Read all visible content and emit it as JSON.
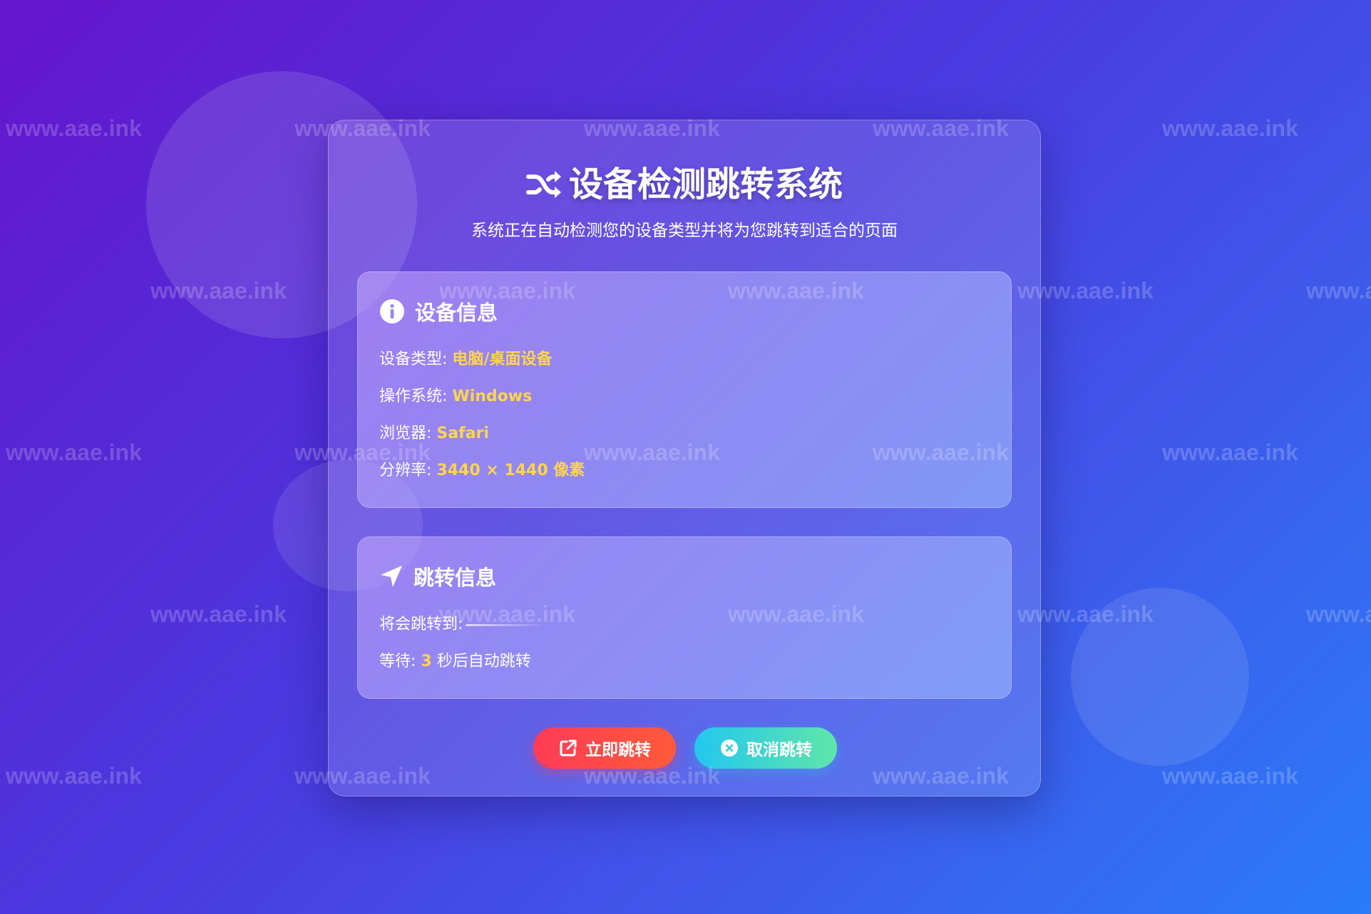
{
  "header": {
    "title": "设备检测跳转系统",
    "subtitle": "系统正在自动检测您的设备类型并将为您跳转到适合的页面",
    "title_icon": "shuffle-icon"
  },
  "device_panel": {
    "heading": "设备信息",
    "heading_icon": "info-circle-icon",
    "rows": [
      {
        "label": "设备类型:",
        "value": "电脑/桌面设备"
      },
      {
        "label": "操作系统:",
        "value": "Windows"
      },
      {
        "label": "浏览器:",
        "value": "Safari"
      },
      {
        "label": "分辨率:",
        "value": "3440 × 1440 像素"
      }
    ]
  },
  "redirect_panel": {
    "heading": "跳转信息",
    "heading_icon": "location-arrow-icon",
    "target_label": "将会跳转到:",
    "wait_label": "等待:",
    "wait_seconds": "3",
    "wait_suffix": "秒后自动跳转"
  },
  "buttons": {
    "redirect_now": "立即跳转",
    "redirect_now_icon": "external-link-icon",
    "cancel": "取消跳转",
    "cancel_icon": "close-circle-icon"
  },
  "watermark": {
    "text": "www.aae.ink"
  },
  "colors": {
    "highlight": "#ffd54a",
    "button_primary": "#ff3b56",
    "button_secondary": "#22c7f0"
  }
}
